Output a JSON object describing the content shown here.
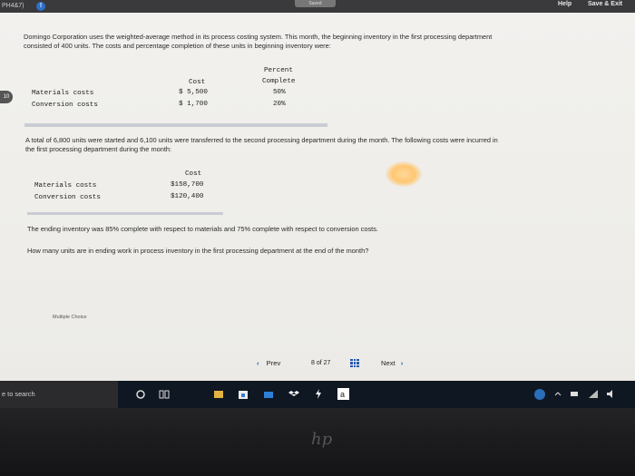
{
  "topbar": {
    "left_text": "PH4&7)",
    "info_icon": "!",
    "saved_label": "Saved",
    "help_label": "Help",
    "save_exit_label": "Save & Exit"
  },
  "question": {
    "number_partial": "10",
    "intro": [
      "Domingo Corporation uses the weighted-average method in its process costing system. This month, the beginning inventory in the first processing department",
      "consisted of 400 units. The costs and percentage completion of these units in beginning inventory were:"
    ],
    "table1": {
      "header_cost": "Cost",
      "header_percent": "Percent",
      "header_complete": "Complete",
      "rows": [
        {
          "label": "Materials costs",
          "cost": "$ 5,500",
          "percent": "50%"
        },
        {
          "label": "Conversion costs",
          "cost": "$ 1,700",
          "percent": "20%"
        }
      ]
    },
    "middle": [
      "A total of 6,800 units were started and 6,100 units were transferred to the second processing department during the month. The following costs were incurred in",
      "the first processing department during the month:"
    ],
    "table2": {
      "header_cost": "Cost",
      "rows": [
        {
          "label": "Materials costs",
          "cost": "$158,700"
        },
        {
          "label": "Conversion costs",
          "cost": "$120,400"
        }
      ]
    },
    "ending_text": "The ending inventory was 85% complete with respect to materials and 75% complete with respect to conversion costs.",
    "ask_text": "How many units are in ending work in process inventory in the first processing department at the end of the month?",
    "multiple_choice_label": "Multiple Choice"
  },
  "navigation": {
    "prev_label": "Prev",
    "page_current": "8",
    "page_of": "of 27",
    "next_label": "Next"
  },
  "taskbar": {
    "search_text": "e to search"
  },
  "bezel": {
    "logo_text": "hp"
  },
  "colors": {
    "accent": "#2556b3",
    "taskbar": "#0f1722"
  }
}
